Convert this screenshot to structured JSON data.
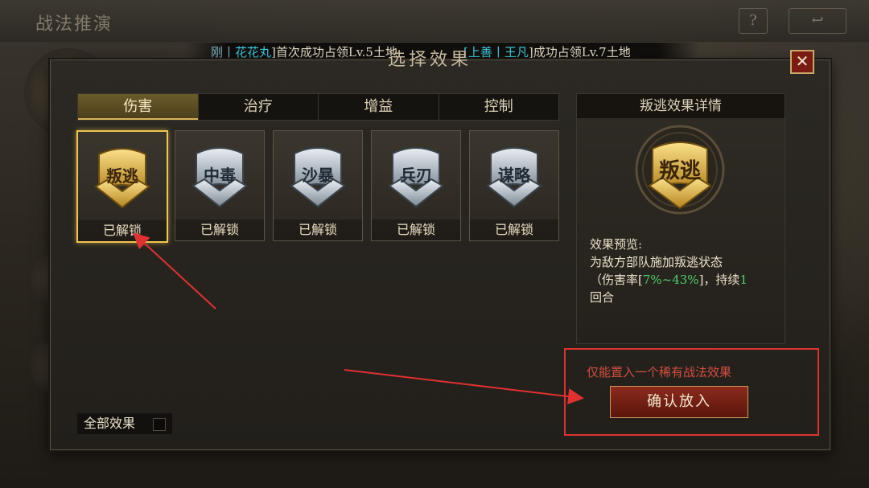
{
  "header": {
    "title": "战法推演"
  },
  "ticker": {
    "seg1_prefix": "刚丨",
    "seg1_name": "花花丸",
    "seg1_text": "]首次成功占领Lv.5土地",
    "seg2_open": "[",
    "seg2_name": "上善丨王凡",
    "seg2_text": "]成功占领Lv.7土地"
  },
  "dialog": {
    "title": "选择效果",
    "tabs": [
      {
        "label": "伤害",
        "active": true
      },
      {
        "label": "治疗",
        "active": false
      },
      {
        "label": "增益",
        "active": false
      },
      {
        "label": "控制",
        "active": false
      }
    ],
    "cards": [
      {
        "name": "叛逃",
        "status": "已解锁",
        "style": "gold",
        "selected": true
      },
      {
        "name": "中毒",
        "status": "已解锁",
        "style": "silver",
        "selected": false
      },
      {
        "name": "沙暴",
        "status": "已解锁",
        "style": "silver",
        "selected": false
      },
      {
        "name": "兵刃",
        "status": "已解锁",
        "style": "silver",
        "selected": false
      },
      {
        "name": "谋略",
        "status": "已解锁",
        "style": "silver",
        "selected": false
      }
    ],
    "detail": {
      "title": "叛逃效果详情",
      "emblem": "叛逃",
      "preview_label": "效果预览:",
      "preview_line1": "为敌方部队施加叛逃状态",
      "preview_line2a": "（伤害率[",
      "preview_range": "7%~43%",
      "preview_line2b": "]，持续",
      "preview_turns": "1",
      "preview_line3": "回合"
    },
    "notice": "仅能置入一个稀有战法效果",
    "confirm_label": "确认放入",
    "all_effects_label": "全部效果",
    "close_icon": "close-icon"
  },
  "colors": {
    "gold": "#f0c450",
    "annotation_red": "#e03131",
    "highlight_green": "#4fd06a",
    "cyan": "#3fd0e8"
  }
}
